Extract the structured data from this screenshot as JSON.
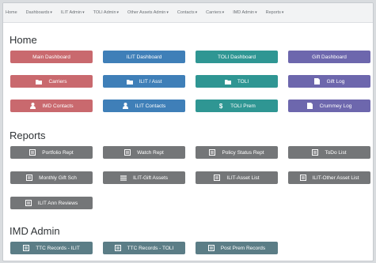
{
  "nav": {
    "items": [
      "Home",
      "Dashboards",
      "ILIT Admin",
      "TOLI Admin",
      "Other Assets Admin",
      "Contacts",
      "Carriers",
      "IMD Admin",
      "Reports"
    ]
  },
  "sections": {
    "home": "Home",
    "reports": "Reports",
    "imd_admin": "IMD Admin"
  },
  "home_buttons": [
    {
      "label": "Main Dashboard",
      "icon": "none",
      "color": "#c9696e"
    },
    {
      "label": "ILIT Dashboard",
      "icon": "none",
      "color": "#3f7fb8"
    },
    {
      "label": "TOLI Dashboard",
      "icon": "none",
      "color": "#2f9693"
    },
    {
      "label": "Gift Dashboard",
      "icon": "none",
      "color": "#6d67ad"
    },
    {
      "label": "Carriers",
      "icon": "folder-icon",
      "color": "#c9696e"
    },
    {
      "label": "ILIT / Asst",
      "icon": "folder-icon",
      "color": "#3f7fb8"
    },
    {
      "label": "TOLI",
      "icon": "folder-icon",
      "color": "#2f9693"
    },
    {
      "label": "Gift Log",
      "icon": "file-icon",
      "color": "#6d67ad"
    },
    {
      "label": "IMD Contacts",
      "icon": "user-icon",
      "color": "#c9696e"
    },
    {
      "label": "ILIT Contacts",
      "icon": "user-icon",
      "color": "#3f7fb8"
    },
    {
      "label": "TOLI Prem",
      "icon": "dollar-icon",
      "color": "#2f9693"
    },
    {
      "label": "Crummey Log",
      "icon": "file-icon",
      "color": "#6d67ad"
    }
  ],
  "report_buttons": [
    {
      "label": "Portfolio Rept",
      "icon": "report-icon"
    },
    {
      "label": "Watch Rept",
      "icon": "report-icon"
    },
    {
      "label": "Policy Status Rept",
      "icon": "report-icon"
    },
    {
      "label": "ToDo List",
      "icon": "report-icon"
    },
    {
      "label": "Monthly Gift Sch",
      "icon": "report-icon"
    },
    {
      "label": "ILIT-Gift Assets",
      "icon": "list-icon"
    },
    {
      "label": "ILIT-Asset List",
      "icon": "report-icon"
    },
    {
      "label": "ILIT-Other Asset List",
      "icon": "report-icon"
    },
    {
      "label": "ILIT Ann Reviews",
      "icon": "report-icon"
    }
  ],
  "imd_buttons": [
    {
      "label": "TTC Records - ILIT",
      "icon": "report-icon"
    },
    {
      "label": "TTC Records - TOLI",
      "icon": "report-icon"
    },
    {
      "label": "Post Prem Records",
      "icon": "report-icon"
    }
  ]
}
